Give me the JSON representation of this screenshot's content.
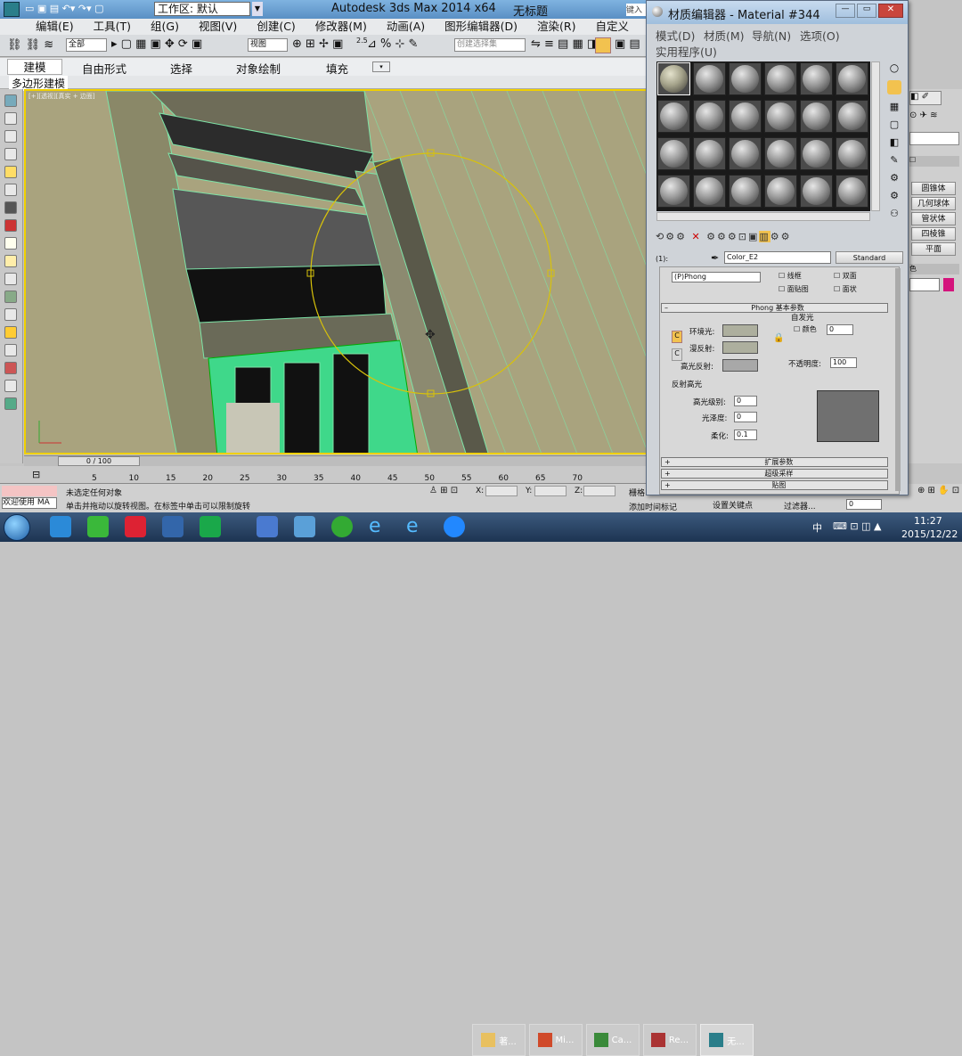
{
  "max": {
    "workspace": "工作区: 默认",
    "title": "Autodesk 3ds Max  2014 x64",
    "doc": "无标题",
    "search": "键入",
    "menu": [
      "编辑(E)",
      "工具(T)",
      "组(G)",
      "视图(V)",
      "创建(C)",
      "修改器(M)",
      "动画(A)",
      "图形编辑器(D)",
      "渲染(R)",
      "自定义(U)"
    ],
    "toolbar": {
      "filter": "全部",
      "view": "视图",
      "snap_value": "2.5",
      "selset": "创建选择集"
    },
    "ribbon_tabs": [
      "建模",
      "自由形式",
      "选择",
      "对象绘制",
      "填充"
    ],
    "ribbon_sub": "多边形建模",
    "viewport_label": "[+][透视][真实 + 边面]",
    "create_panel": [
      "圆锥体",
      "几何球体",
      "管状体",
      "四棱锥",
      "平面"
    ],
    "create_header": "色",
    "timeline": {
      "frame": "0 / 100",
      "ticks": [
        "5",
        "10",
        "15",
        "20",
        "25",
        "30",
        "35",
        "40",
        "45",
        "50",
        "55",
        "60",
        "65",
        "70"
      ]
    },
    "status": {
      "mini": "欢迎使用 MA",
      "line1": "未选定任何对象",
      "line2": "单击并拖动以旋转视图。在标签中单击可以限制旋转",
      "x": "X:",
      "y": "Y:",
      "z": "Z:",
      "grid": "栅格",
      "add_tag": "添加时间标记",
      "set_key": "设置关键点",
      "filter": "过滤器...",
      "frame": "0"
    }
  },
  "mat": {
    "title": "材质编辑器 - Material #344",
    "menu": [
      "模式(D)",
      "材质(M)",
      "导航(N)",
      "选项(O)",
      "实用程序(U)"
    ],
    "name_label": "(1):",
    "name": "Color_E2",
    "type": "Standard",
    "shader": "(P)Phong",
    "checks": [
      "线框",
      "双面",
      "面贴图",
      "面状"
    ],
    "phong_title": "Phong 基本参数",
    "self_illum": "自发光",
    "color_label": "颜色",
    "color_val": "0",
    "ambient": "环境光:",
    "diffuse": "漫反射:",
    "specular": "高光反射:",
    "opacity_label": "不透明度:",
    "opacity": "100",
    "reflect_title": "反射高光",
    "spec_level_label": "高光级别:",
    "spec_level": "0",
    "gloss_label": "光泽度:",
    "gloss": "0",
    "soften_label": "柔化:",
    "soften": "0.1",
    "rollouts": [
      "扩展参数",
      "超级采样",
      "贴图"
    ]
  },
  "taskbar": {
    "items": [
      "著...",
      "Mi...",
      "Ca...",
      "Re...",
      "无..."
    ],
    "lang": "中",
    "time": "11:27",
    "date": "2015/12/22"
  }
}
